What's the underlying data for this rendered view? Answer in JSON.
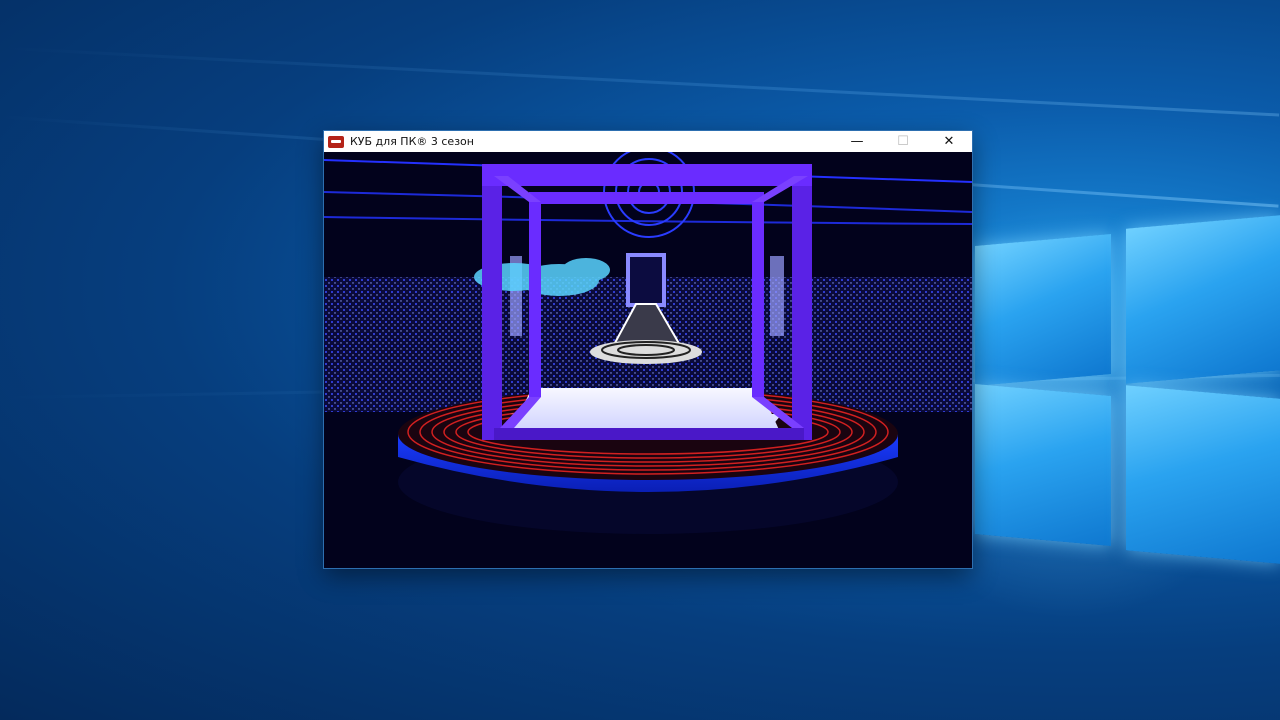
{
  "window": {
    "title": "КУБ для ПК® 3 сезон",
    "controls": {
      "minimize": "—",
      "maximize": "☐",
      "close": "✕"
    }
  },
  "icons": {
    "app": "kub-logo-icon",
    "minimize": "minimize-icon",
    "maximize": "maximize-icon",
    "close": "close-icon"
  },
  "colors": {
    "cube_frame": "#6a2cff",
    "stage_ring": "#0a3cff",
    "stage_lines": "#d12020",
    "floor_panel": "#f4f4f8",
    "desktop_blue": "#0b5cab"
  }
}
